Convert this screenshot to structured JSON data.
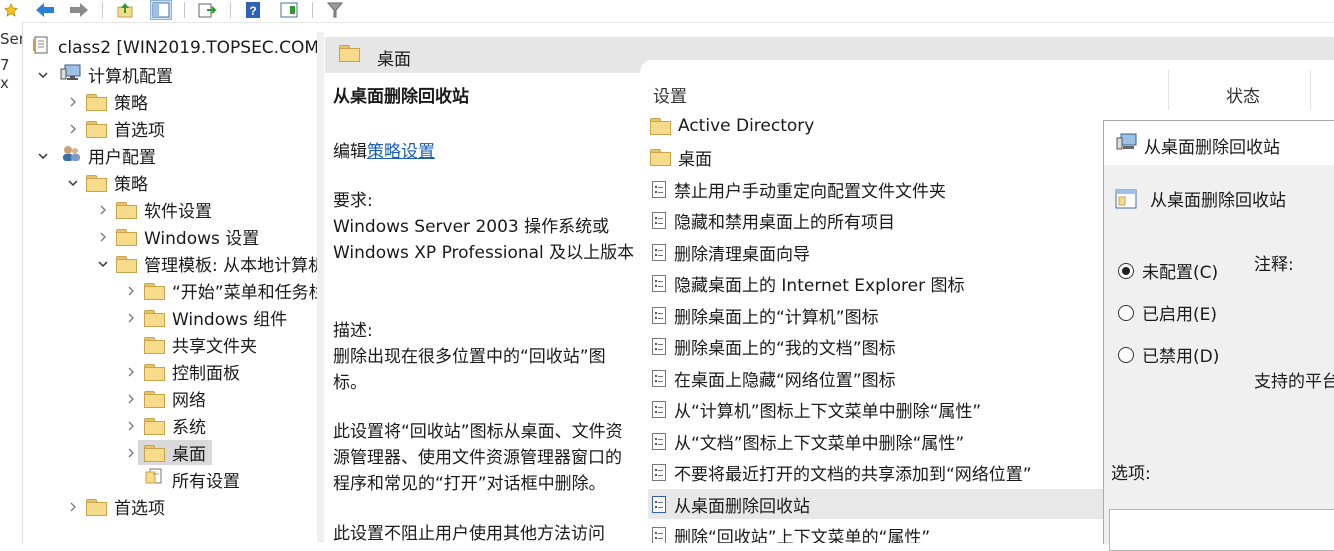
{
  "left_edge": {
    "fragments": [
      "Ser",
      "7 x"
    ]
  },
  "tree": {
    "root": "class2 [WIN2019.TOPSEC.COM",
    "items": [
      {
        "label": "计算机配置"
      },
      {
        "label": "策略"
      },
      {
        "label": "首选项"
      },
      {
        "label": "用户配置"
      },
      {
        "label": "策略"
      },
      {
        "label": "软件设置"
      },
      {
        "label": "Windows 设置"
      },
      {
        "label": "管理模板: 从本地计算机"
      },
      {
        "label": "“开始”菜单和任务栏"
      },
      {
        "label": "Windows 组件"
      },
      {
        "label": "共享文件夹"
      },
      {
        "label": "控制面板"
      },
      {
        "label": "网络"
      },
      {
        "label": "系统"
      },
      {
        "label": "桌面"
      },
      {
        "label": "所有设置"
      },
      {
        "label": "首选项"
      }
    ]
  },
  "header": {
    "title": "桌面"
  },
  "desc": {
    "title": "从桌面删除回收站",
    "edit_prefix": "编辑",
    "edit_link": "策略设置",
    "req_label": "要求:",
    "req_text": "Windows Server 2003 操作系统或 Windows XP Professional 及以上版本",
    "desc_label": "描述:",
    "desc_text": "删除出现在很多位置中的“回收站”图标。",
    "p3": "此设置将“回收站”图标从桌面、文件资源管理器、使用文件资源管理器窗口的程序和常见的“打开”对话框中删除。",
    "p4": "此设置不阻止用户使用其他方法访问"
  },
  "list": {
    "col_setting": "设置",
    "col_state": "状态",
    "items": [
      {
        "label": "Active Directory",
        "type": "folder"
      },
      {
        "label": "桌面",
        "type": "folder"
      },
      {
        "label": "禁止用户手动重定向配置文件文件夹",
        "type": "setting"
      },
      {
        "label": "隐藏和禁用桌面上的所有项目",
        "type": "setting"
      },
      {
        "label": "删除清理桌面向导",
        "type": "setting"
      },
      {
        "label": "隐藏桌面上的 Internet Explorer 图标",
        "type": "setting"
      },
      {
        "label": "删除桌面上的“计算机”图标",
        "type": "setting"
      },
      {
        "label": "删除桌面上的“我的文档”图标",
        "type": "setting"
      },
      {
        "label": "在桌面上隐藏“网络位置”图标",
        "type": "setting"
      },
      {
        "label": "从“计算机”图标上下文菜单中删除“属性”",
        "type": "setting"
      },
      {
        "label": "从“文档”图标上下文菜单中删除“属性”",
        "type": "setting"
      },
      {
        "label": "不要将最近打开的文档的共享添加到“网络位置”",
        "type": "setting"
      },
      {
        "label": "从桌面删除回收站",
        "type": "setting"
      },
      {
        "label": "删除“回收站”上下文菜单的“属性”",
        "type": "setting"
      }
    ]
  },
  "dialog": {
    "window_title": "从桌面删除回收站",
    "setting_name": "从桌面删除回收站",
    "radio_not_configured": "未配置(C)",
    "radio_enabled": "已启用(E)",
    "radio_disabled": "已禁用(D)",
    "note_label": "注释:",
    "supported_label": "支持的平台",
    "options_label": "选项:"
  },
  "colors": {
    "selection": "#d9d9d9",
    "link": "#1a5fb4",
    "folder": "#f6dc8a",
    "header": "#e6e6e6",
    "dialog_bg": "#f0f0f0"
  }
}
